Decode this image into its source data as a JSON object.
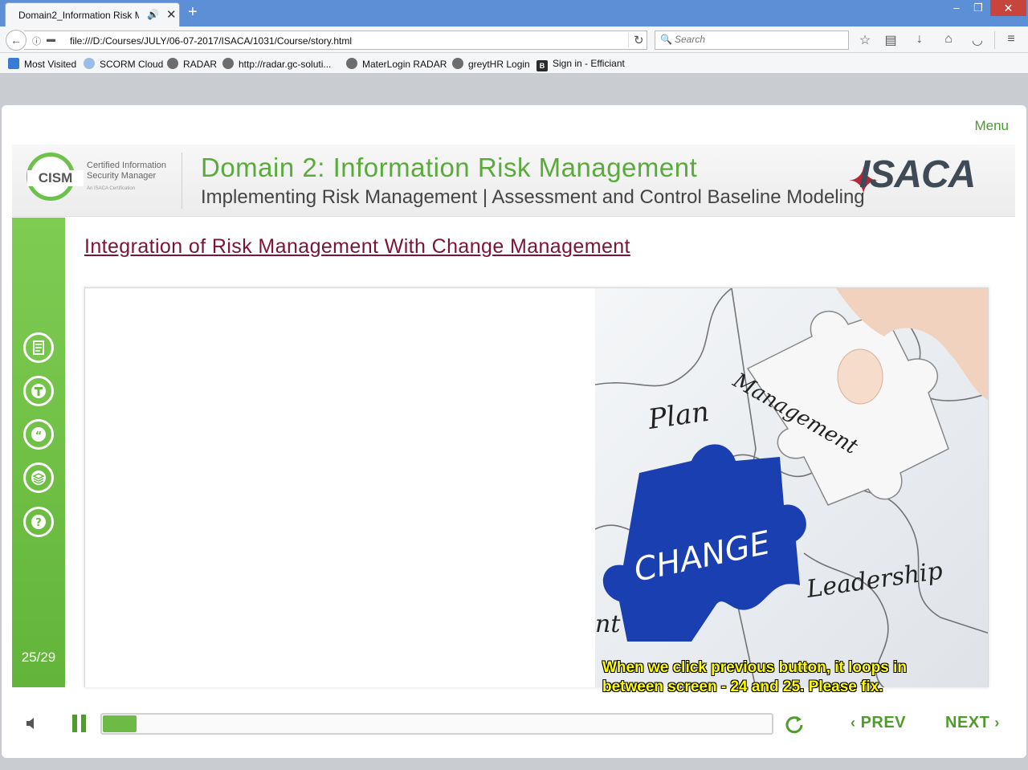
{
  "browser": {
    "tab_title": "Domain2_Information Risk M",
    "new_tab": "+",
    "window_controls": {
      "minimize": "–",
      "maximize": "❐",
      "close": "✕"
    },
    "url": "file:///D:/Courses/JULY/06-07-2017/ISACA/1031/Course/story.html",
    "search_placeholder": "Search",
    "bookmarks": [
      "Most Visited",
      "SCORM Cloud",
      "RADAR",
      "http://radar.gc-soluti...",
      "MaterLogin RADAR",
      "greytHR Login",
      "Sign in - Efficiant"
    ]
  },
  "course": {
    "menu_label": "Menu",
    "banner": {
      "cism_logo": "CISM",
      "cism_line1": "Certified Information",
      "cism_line2": "Security Manager",
      "cism_sub": "An ISACA Certification",
      "domain_title": "Domain 2: Information Risk Management",
      "domain_subtitle": "Implementing Risk Management | Assessment and Control Baseline Modeling",
      "isaca_logo": "ISACA"
    },
    "sidebar_icons": [
      "notes-icon",
      "glossary-icon",
      "quote-icon",
      "resources-icon",
      "help-icon"
    ],
    "slide_counter": "25/29",
    "slide_heading": "Integration of Risk Management With Change Management",
    "puzzle_words": {
      "plan": "Plan",
      "management": "Management",
      "change": "CHANGE",
      "leadership": "Leadership",
      "partial": "nt"
    },
    "subtitle_note": [
      "When we click previous button, it loops in",
      "between screen - 24 and 25. Please fix."
    ],
    "controls": {
      "prev_label": "PREV",
      "next_label": "NEXT",
      "progress_fraction": 0.05
    }
  },
  "colors": {
    "accent_green": "#5bab3c",
    "heading_maroon": "#7b1436",
    "subtitle_yellow": "#ffff00",
    "puzzle_blue": "#1a3fb0"
  }
}
